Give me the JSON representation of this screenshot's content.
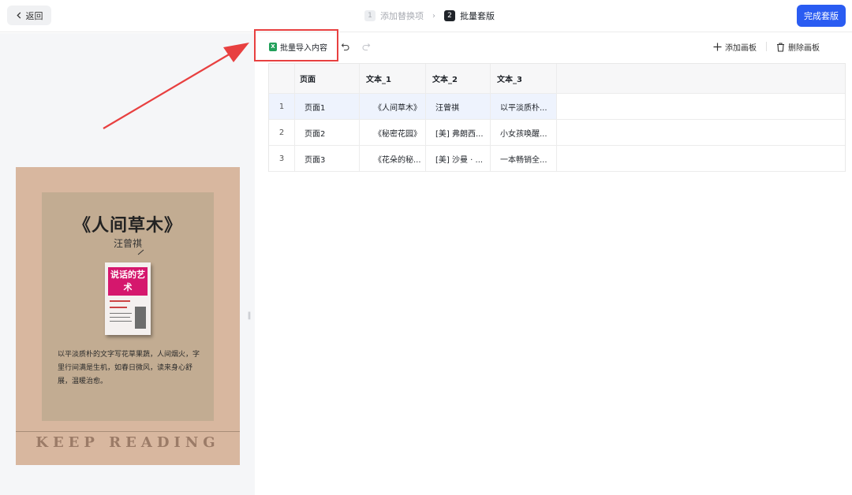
{
  "header": {
    "back_label": "返回",
    "steps": [
      {
        "num": "1",
        "label": "添加替换项"
      },
      {
        "num": "2",
        "label": "批量套版"
      }
    ],
    "done_label": "完成套版"
  },
  "toolbar": {
    "import_label": "批量导入内容",
    "add_board_label": "添加画板",
    "delete_board_label": "删除画板"
  },
  "table": {
    "columns": [
      "页面",
      "文本_1",
      "文本_2",
      "文本_3"
    ],
    "rows": [
      {
        "index": "1",
        "cells": [
          "页面1",
          "《人间草木》",
          "汪曾祺",
          "以平淡质朴..."
        ]
      },
      {
        "index": "2",
        "cells": [
          "页面2",
          "《秘密花园》",
          "[美] 弗朗西...",
          "小女孩唤醒..."
        ]
      },
      {
        "index": "3",
        "cells": [
          "页面3",
          "《花朵的秘...",
          "[美] 沙曼 · ...",
          "一本畅销全..."
        ]
      }
    ]
  },
  "poster": {
    "title": "《人间草木》",
    "author": "汪曾祺",
    "book_cover_text": "说话的艺术",
    "description": "以平淡质朴的文字写花草果蔬，人间烟火，字里行间满是生机，如春日微风，读来身心舒展，温暖治愈。",
    "footer": "KEEP READING"
  },
  "colors": {
    "accent": "#2a5cf2",
    "highlight": "#e84040",
    "poster_bg": "#d8b79f"
  }
}
